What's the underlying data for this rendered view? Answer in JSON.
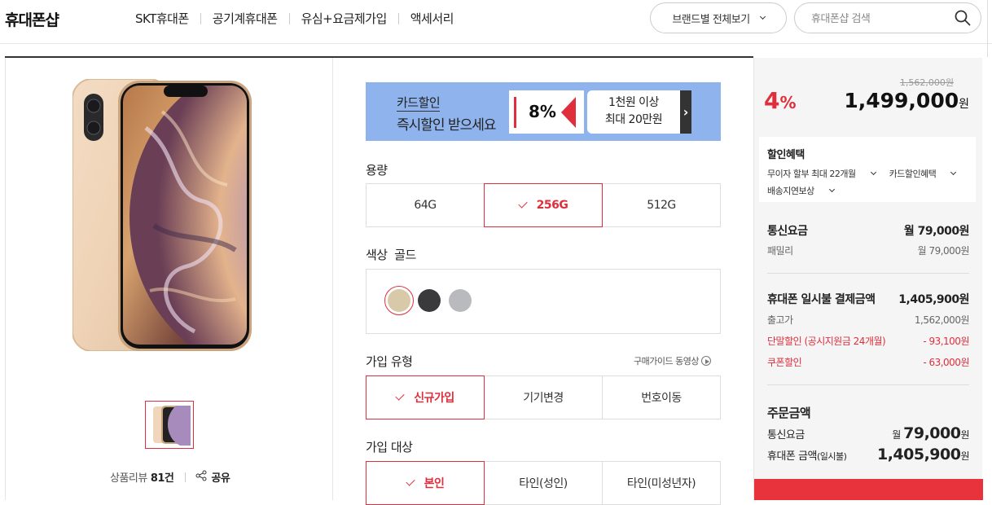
{
  "header": {
    "logo": "휴대폰샵",
    "nav": [
      "SKT휴대폰",
      "공기계휴대폰",
      "유심+요금제가입",
      "액세서리"
    ],
    "brand_button": "브랜드별 전체보기",
    "search_placeholder": "휴대폰샵 검색"
  },
  "product": {
    "review_label": "상품리뷰",
    "review_count": "81건",
    "share_label": "공유"
  },
  "banner": {
    "title": "카드할인",
    "subtitle": "즉시할인 받으세요",
    "percent": "8%",
    "info_line1": "1천원 이상",
    "info_line2": "최대 20만원"
  },
  "storage": {
    "label": "용량",
    "options": [
      "64G",
      "256G",
      "512G"
    ],
    "selected": "256G"
  },
  "color": {
    "label": "색상",
    "selected_name": "골드",
    "swatches": [
      "#d8c9a8",
      "#3a3a3c",
      "#b9babe"
    ]
  },
  "join_type": {
    "label": "가입 유형",
    "guide": "구매가이드 동영상",
    "options": [
      "신규가입",
      "기기변경",
      "번호이동"
    ],
    "selected": "신규가입"
  },
  "join_target": {
    "label": "가입 대상",
    "options": [
      "본인",
      "타인(성인)",
      "타인(미성년자)"
    ],
    "selected": "본인"
  },
  "summary": {
    "discount_rate": "4",
    "discount_unit": "%",
    "original_price": "1,562,000원",
    "price": "1,499,000",
    "price_unit": "원",
    "benefit_title": "할인혜택",
    "benefit_links": [
      "무이자 할부 최대 22개월",
      "카드할인혜택",
      "배송지연보상"
    ],
    "plan_label": "통신요금",
    "plan_value": "월 79,000원",
    "plan_name": "패밀리",
    "plan_name_value": "월 79,000원",
    "lump_label": "휴대폰 일시불 결제금액",
    "lump_value": "1,405,900원",
    "release_label": "출고가",
    "release_value": "1,562,000원",
    "device_disc_label": "단말할인 (공시지원금 24개월)",
    "device_disc_value": "- 93,100원",
    "coupon_label": "쿠폰할인",
    "coupon_value": "- 63,000원",
    "order_label": "주문금액",
    "order_plan_label": "통신요금",
    "order_plan_prefix": "월 ",
    "order_plan_value": "79,000",
    "order_plan_unit": "원",
    "order_phone_label": "휴대폰 금액",
    "order_phone_sub": "(일시불)",
    "order_phone_value": "1,405,900",
    "order_phone_unit": "원"
  }
}
